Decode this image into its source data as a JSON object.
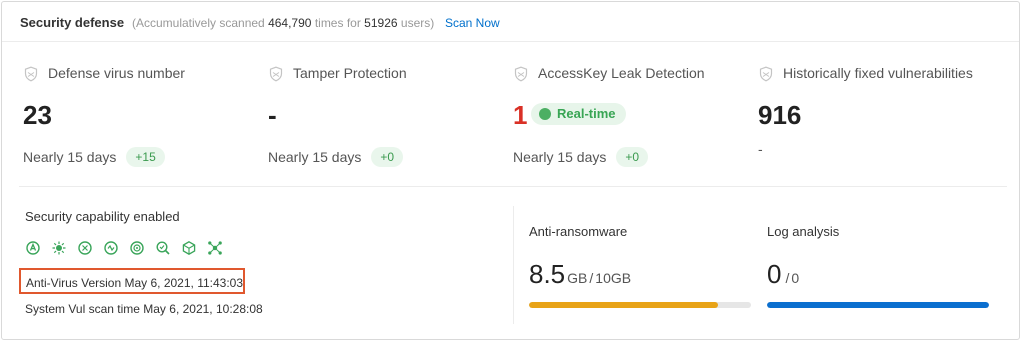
{
  "header": {
    "title": "Security defense",
    "subtitle_prefix": "(Accumulatively scanned",
    "scan_count": "464,790",
    "subtitle_middle": "times for",
    "user_count": "51926",
    "subtitle_suffix": "users)",
    "scan_now_label": "Scan Now"
  },
  "stats": [
    {
      "label": "Defense virus number",
      "value": "23",
      "sub_label": "Nearly 15 days",
      "delta": "+15",
      "icon": "shield-icon"
    },
    {
      "label": "Tamper Protection",
      "value": "-",
      "sub_label": "Nearly 15 days",
      "delta": "+0",
      "icon": "shield-icon"
    },
    {
      "label": "AccessKey Leak Detection",
      "value": "1",
      "value_color": "#d93026",
      "badge": "Real-time",
      "sub_label": "Nearly 15 days",
      "delta": "+0",
      "icon": "shield-icon"
    },
    {
      "label": "Historically fixed vulnerabilities",
      "value": "916",
      "sub_label": "-",
      "icon": "shield-icon"
    }
  ],
  "capabilities": {
    "title": "Security capability enabled",
    "icons": [
      "antivirus-icon",
      "bug-icon",
      "tamper-icon",
      "vulnerability-icon",
      "baseline-icon",
      "search-scan-icon",
      "container-icon",
      "network-icon"
    ],
    "antivirus_version": "Anti-Virus Version May 6, 2021, 11:43:03",
    "vul_scan_time": "System Vul scan time May 6, 2021, 10:28:08"
  },
  "usage": [
    {
      "title": "Anti-ransomware",
      "used": "8.5",
      "used_unit": "GB",
      "separator": "/",
      "total": "10GB",
      "fraction": 0.85,
      "color": "#e8a317"
    },
    {
      "title": "Log analysis",
      "used": "0",
      "used_unit": "",
      "separator": "/",
      "total": "0",
      "fraction": 1.0,
      "color": "#0b6fcf"
    }
  ],
  "colors": {
    "accent": "#0070cc",
    "success": "#3a9a4e",
    "danger": "#d93026",
    "highlight_box": "#e0582e"
  }
}
